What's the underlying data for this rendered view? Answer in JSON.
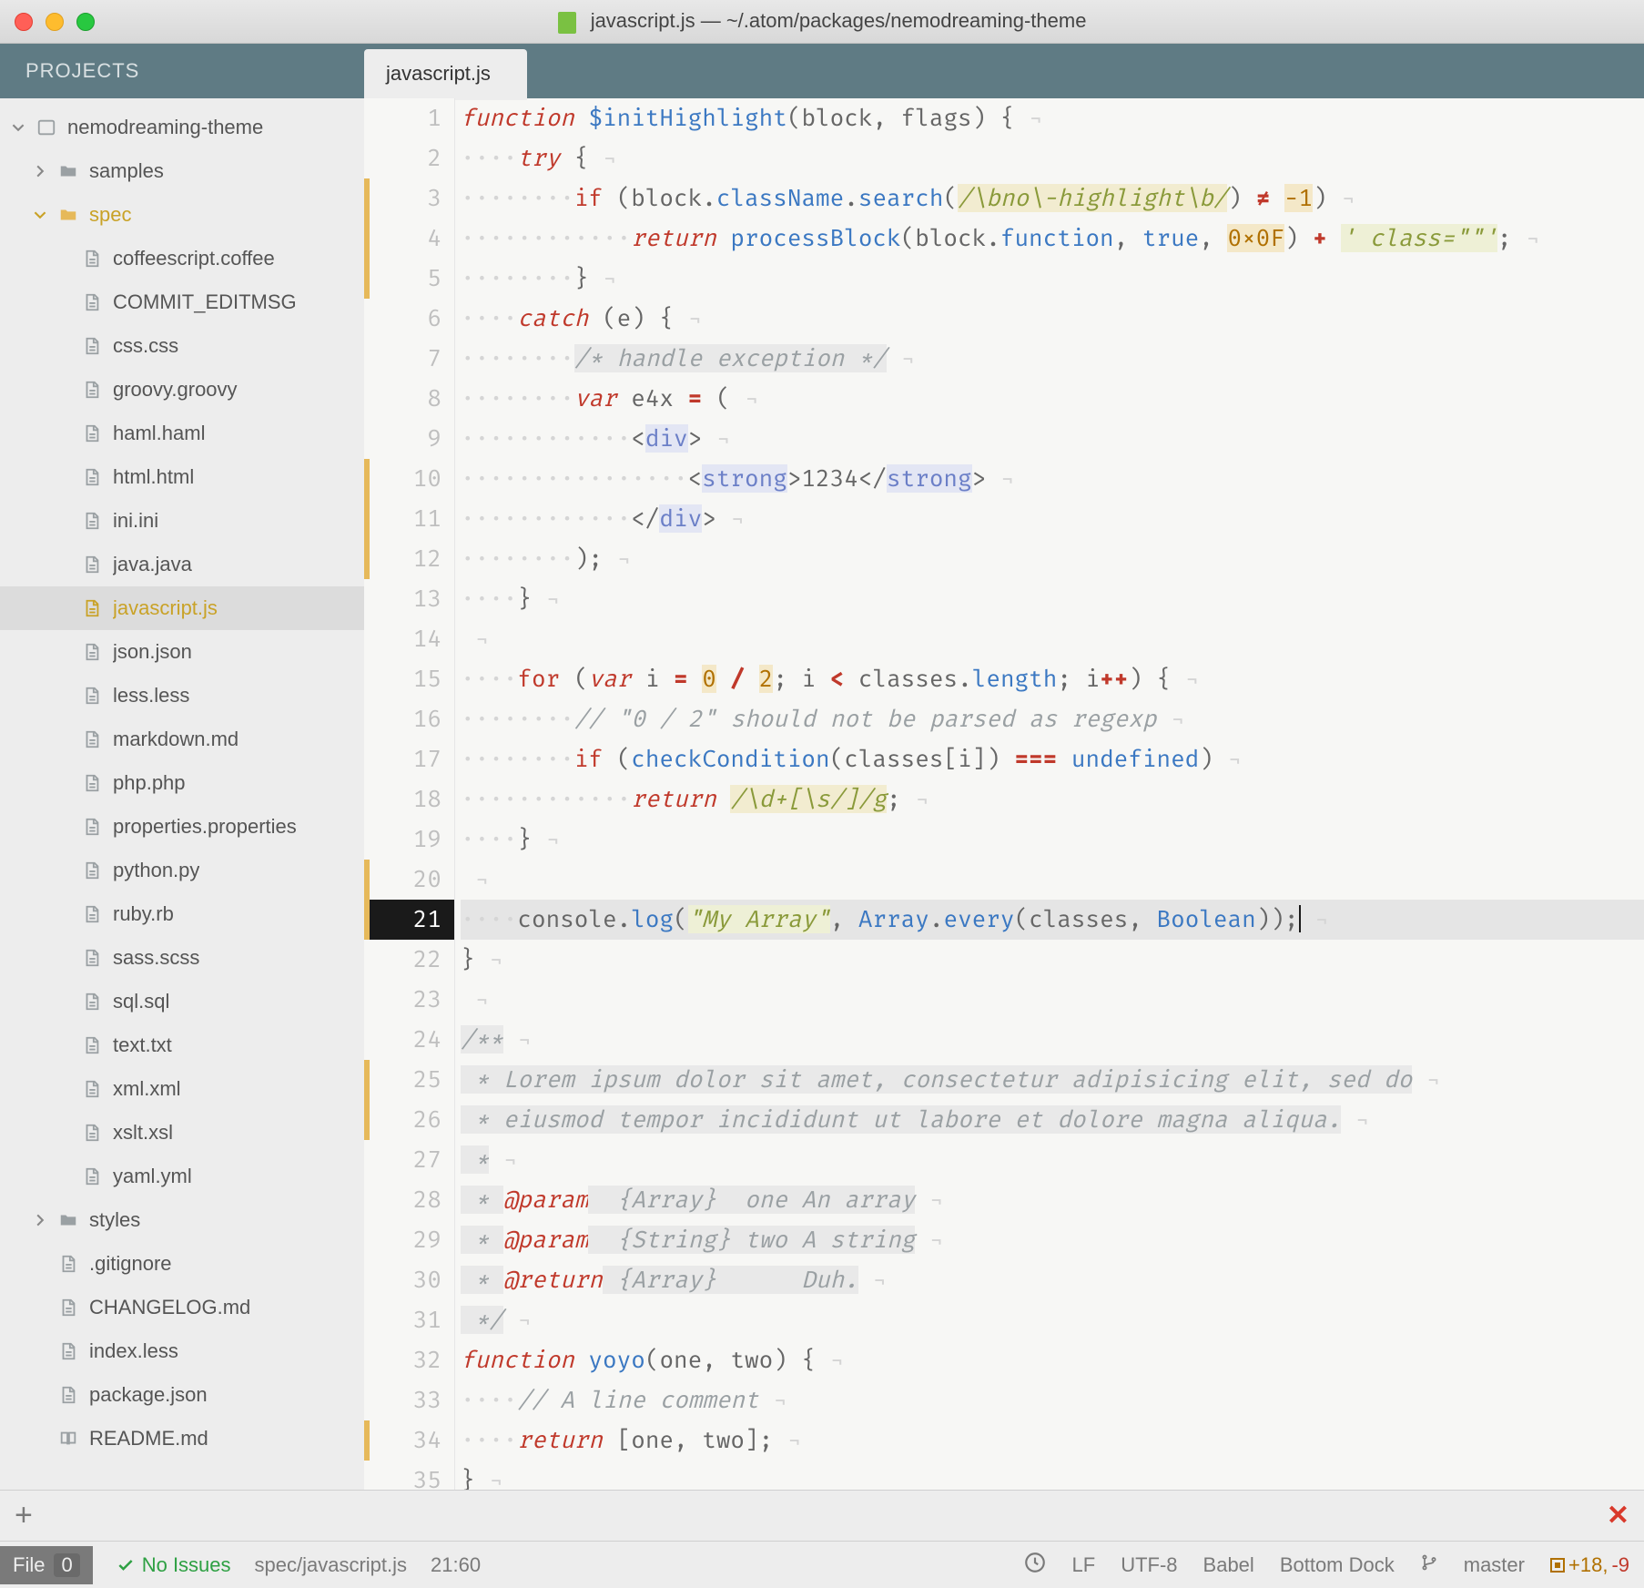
{
  "window": {
    "title": "javascript.js — ~/.atom/packages/nemodreaming-theme"
  },
  "sidebar": {
    "header": "PROJECTS",
    "root": {
      "label": "nemodreaming-theme",
      "expanded": true
    },
    "folders": {
      "samples": {
        "label": "samples",
        "expanded": false
      },
      "spec": {
        "label": "spec",
        "expanded": true
      },
      "styles": {
        "label": "styles",
        "expanded": false
      }
    },
    "spec_files": [
      "coffeescript.coffee",
      "COMMIT_EDITMSG",
      "css.css",
      "groovy.groovy",
      "haml.haml",
      "html.html",
      "ini.ini",
      "java.java",
      "javascript.js",
      "json.json",
      "less.less",
      "markdown.md",
      "php.php",
      "properties.properties",
      "python.py",
      "ruby.rb",
      "sass.scss",
      "sql.sql",
      "text.txt",
      "xml.xml",
      "xslt.xsl",
      "yaml.yml"
    ],
    "root_files": [
      ".gitignore",
      "CHANGELOG.md",
      "index.less",
      "package.json",
      "README.md"
    ],
    "selected_file": "javascript.js"
  },
  "tabs": {
    "active": "javascript.js"
  },
  "editor": {
    "line_count": 35,
    "cursor_line": 21,
    "modified_marker_lines": [
      3,
      4,
      5,
      10,
      11,
      12,
      20,
      21,
      25,
      26,
      34
    ],
    "lines": {
      "l1": {
        "pre": "",
        "tokens": [
          [
            "kw",
            "function"
          ],
          [
            "pn",
            " "
          ],
          [
            "fn",
            "$initHighlight"
          ],
          [
            "pn",
            "("
          ],
          [
            "pn",
            "block, flags"
          ],
          [
            "pn",
            ") {"
          ]
        ]
      },
      "l2": {
        "pre": "    ",
        "tokens": [
          [
            "kw",
            "try"
          ],
          [
            "pn",
            " {"
          ]
        ]
      },
      "l3": {
        "pre": "        ",
        "tokens": [
          [
            "kw2",
            "if"
          ],
          [
            "pn",
            " ("
          ],
          [
            "pn",
            "block"
          ],
          [
            "pn",
            "."
          ],
          [
            "fn",
            "className"
          ],
          [
            "pn",
            "."
          ],
          [
            "fn",
            "search"
          ],
          [
            "pn",
            "("
          ],
          [
            "rgx",
            "/\\bno\\-highlight\\b/"
          ],
          [
            "pn",
            ") "
          ],
          [
            "op",
            "≠"
          ],
          [
            "pn",
            " "
          ],
          [
            "num",
            "-1"
          ],
          [
            "pn",
            ")"
          ]
        ]
      },
      "l4": {
        "pre": "            ",
        "tokens": [
          [
            "kw",
            "return"
          ],
          [
            "pn",
            " "
          ],
          [
            "fn",
            "processBlock"
          ],
          [
            "pn",
            "("
          ],
          [
            "pn",
            "block"
          ],
          [
            "pn",
            "."
          ],
          [
            "cnst",
            "function"
          ],
          [
            "pn",
            ", "
          ],
          [
            "cnst",
            "true"
          ],
          [
            "pn",
            ", "
          ],
          [
            "num",
            "0×0F"
          ],
          [
            "pn",
            ") "
          ],
          [
            "op",
            "+"
          ],
          [
            "pn",
            " "
          ],
          [
            "str",
            "' class=\"\"'"
          ],
          [
            "pn",
            ";"
          ]
        ]
      },
      "l5": {
        "pre": "        ",
        "tokens": [
          [
            "pn",
            "}"
          ]
        ]
      },
      "l6": {
        "pre": "    ",
        "tokens": [
          [
            "kw",
            "catch"
          ],
          [
            "pn",
            " ("
          ],
          [
            "pn",
            "e"
          ],
          [
            "pn",
            ") {"
          ]
        ]
      },
      "l7": {
        "pre": "        ",
        "tokens": [
          [
            "cm",
            "/* handle exception */"
          ]
        ]
      },
      "l8": {
        "pre": "        ",
        "tokens": [
          [
            "kw",
            "var"
          ],
          [
            "pn",
            " e4x "
          ],
          [
            "op",
            "="
          ],
          [
            "pn",
            " ("
          ]
        ]
      },
      "l9": {
        "pre": "            ",
        "tokens": [
          [
            "pn",
            "<"
          ],
          [
            "tag",
            "div"
          ],
          [
            "pn",
            ">"
          ]
        ]
      },
      "l10": {
        "pre": "                ",
        "tokens": [
          [
            "pn",
            "<"
          ],
          [
            "tag",
            "strong"
          ],
          [
            "pn",
            ">1234</"
          ],
          [
            "tag",
            "strong"
          ],
          [
            "pn",
            ">"
          ]
        ]
      },
      "l11": {
        "pre": "            ",
        "tokens": [
          [
            "pn",
            "</"
          ],
          [
            "tag",
            "div"
          ],
          [
            "pn",
            ">"
          ]
        ]
      },
      "l12": {
        "pre": "        ",
        "tokens": [
          [
            "pn",
            ");"
          ]
        ]
      },
      "l13": {
        "pre": "    ",
        "tokens": [
          [
            "pn",
            "}"
          ]
        ]
      },
      "l14": {
        "pre": "",
        "tokens": []
      },
      "l15": {
        "pre": "    ",
        "tokens": [
          [
            "kw2",
            "for"
          ],
          [
            "pn",
            " ("
          ],
          [
            "kw",
            "var"
          ],
          [
            "pn",
            " i "
          ],
          [
            "op",
            "="
          ],
          [
            "pn",
            " "
          ],
          [
            "num",
            "0"
          ],
          [
            "pn",
            " "
          ],
          [
            "op",
            "/"
          ],
          [
            "pn",
            " "
          ],
          [
            "num",
            "2"
          ],
          [
            "pn",
            "; i "
          ],
          [
            "op",
            "<"
          ],
          [
            "pn",
            " classes"
          ],
          [
            "pn",
            "."
          ],
          [
            "fn",
            "length"
          ],
          [
            "pn",
            "; i"
          ],
          [
            "op",
            "++"
          ],
          [
            "pn",
            ") {"
          ]
        ]
      },
      "l16": {
        "pre": "        ",
        "tokens": [
          [
            "cm-plain",
            "// \"0 / 2\" should not be parsed as regexp"
          ]
        ]
      },
      "l17": {
        "pre": "        ",
        "tokens": [
          [
            "kw2",
            "if"
          ],
          [
            "pn",
            " ("
          ],
          [
            "fn",
            "checkCondition"
          ],
          [
            "pn",
            "("
          ],
          [
            "pn",
            "classes[i]"
          ],
          [
            "pn",
            ") "
          ],
          [
            "op",
            "==="
          ],
          [
            "pn",
            " "
          ],
          [
            "cnst",
            "undefined"
          ],
          [
            "pn",
            ")"
          ]
        ]
      },
      "l18": {
        "pre": "            ",
        "tokens": [
          [
            "kw",
            "return"
          ],
          [
            "pn",
            " "
          ],
          [
            "rgx",
            "/\\d+[\\s/]/g"
          ],
          [
            "pn",
            ";"
          ]
        ]
      },
      "l19": {
        "pre": "    ",
        "tokens": [
          [
            "pn",
            "}"
          ]
        ]
      },
      "l20": {
        "pre": "",
        "tokens": []
      },
      "l21": {
        "pre": "    ",
        "tokens": [
          [
            "pn",
            "console"
          ],
          [
            "pn",
            "."
          ],
          [
            "fn",
            "log"
          ],
          [
            "pn",
            "("
          ],
          [
            "str",
            "\"My Array\""
          ],
          [
            "pn",
            ", "
          ],
          [
            "cnst",
            "Array"
          ],
          [
            "pn",
            "."
          ],
          [
            "fn",
            "every"
          ],
          [
            "pn",
            "("
          ],
          [
            "pn",
            "classes, "
          ],
          [
            "cnst",
            "Boolean"
          ],
          [
            "pn",
            "));"
          ]
        ]
      },
      "l22": {
        "pre": "",
        "tokens": [
          [
            "pn",
            "}"
          ]
        ]
      },
      "l23": {
        "pre": "",
        "tokens": []
      },
      "l24": {
        "pre": "",
        "tokens": [
          [
            "cm",
            "/**"
          ]
        ]
      },
      "l25": {
        "pre": "",
        "tokens": [
          [
            "cm",
            " * Lorem ipsum dolor sit amet, consectetur adipisicing elit, sed do"
          ]
        ]
      },
      "l26": {
        "pre": "",
        "tokens": [
          [
            "cm",
            " * eiusmod tempor incididunt ut labore et dolore magna aliqua."
          ]
        ]
      },
      "l27": {
        "pre": "",
        "tokens": [
          [
            "cm",
            " *"
          ]
        ]
      },
      "l28": {
        "pre": "",
        "tokens": [
          [
            "cm",
            " * "
          ],
          [
            "prm",
            "@param"
          ],
          [
            "cm",
            "  {Array}  one An array"
          ]
        ]
      },
      "l29": {
        "pre": "",
        "tokens": [
          [
            "cm",
            " * "
          ],
          [
            "prm",
            "@param"
          ],
          [
            "cm",
            "  {String} two A string"
          ]
        ]
      },
      "l30": {
        "pre": "",
        "tokens": [
          [
            "cm",
            " * "
          ],
          [
            "prm",
            "@return"
          ],
          [
            "cm",
            " {Array}      Duh."
          ]
        ]
      },
      "l31": {
        "pre": "",
        "tokens": [
          [
            "cm",
            " */"
          ]
        ]
      },
      "l32": {
        "pre": "",
        "tokens": [
          [
            "kw",
            "function"
          ],
          [
            "pn",
            " "
          ],
          [
            "fn",
            "yoyo"
          ],
          [
            "pn",
            "("
          ],
          [
            "pn",
            "one, two"
          ],
          [
            "pn",
            ") {"
          ]
        ]
      },
      "l33": {
        "pre": "    ",
        "tokens": [
          [
            "cm-plain",
            "// A line comment"
          ]
        ]
      },
      "l34": {
        "pre": "    ",
        "tokens": [
          [
            "kw",
            "return"
          ],
          [
            "pn",
            " ["
          ],
          [
            "pn",
            "one, two"
          ],
          [
            "pn",
            "];"
          ]
        ]
      },
      "l35": {
        "pre": "",
        "tokens": [
          [
            "pn",
            "}"
          ]
        ]
      }
    }
  },
  "status": {
    "file_label": "File",
    "file_count": "0",
    "issues": "No Issues",
    "path": "spec/javascript.js",
    "cursor": "21:60",
    "eol": "LF",
    "encoding": "UTF-8",
    "grammar": "Babel",
    "dock": "Bottom Dock",
    "branch": "master",
    "git_add": "+18,",
    "git_del": "-9"
  }
}
